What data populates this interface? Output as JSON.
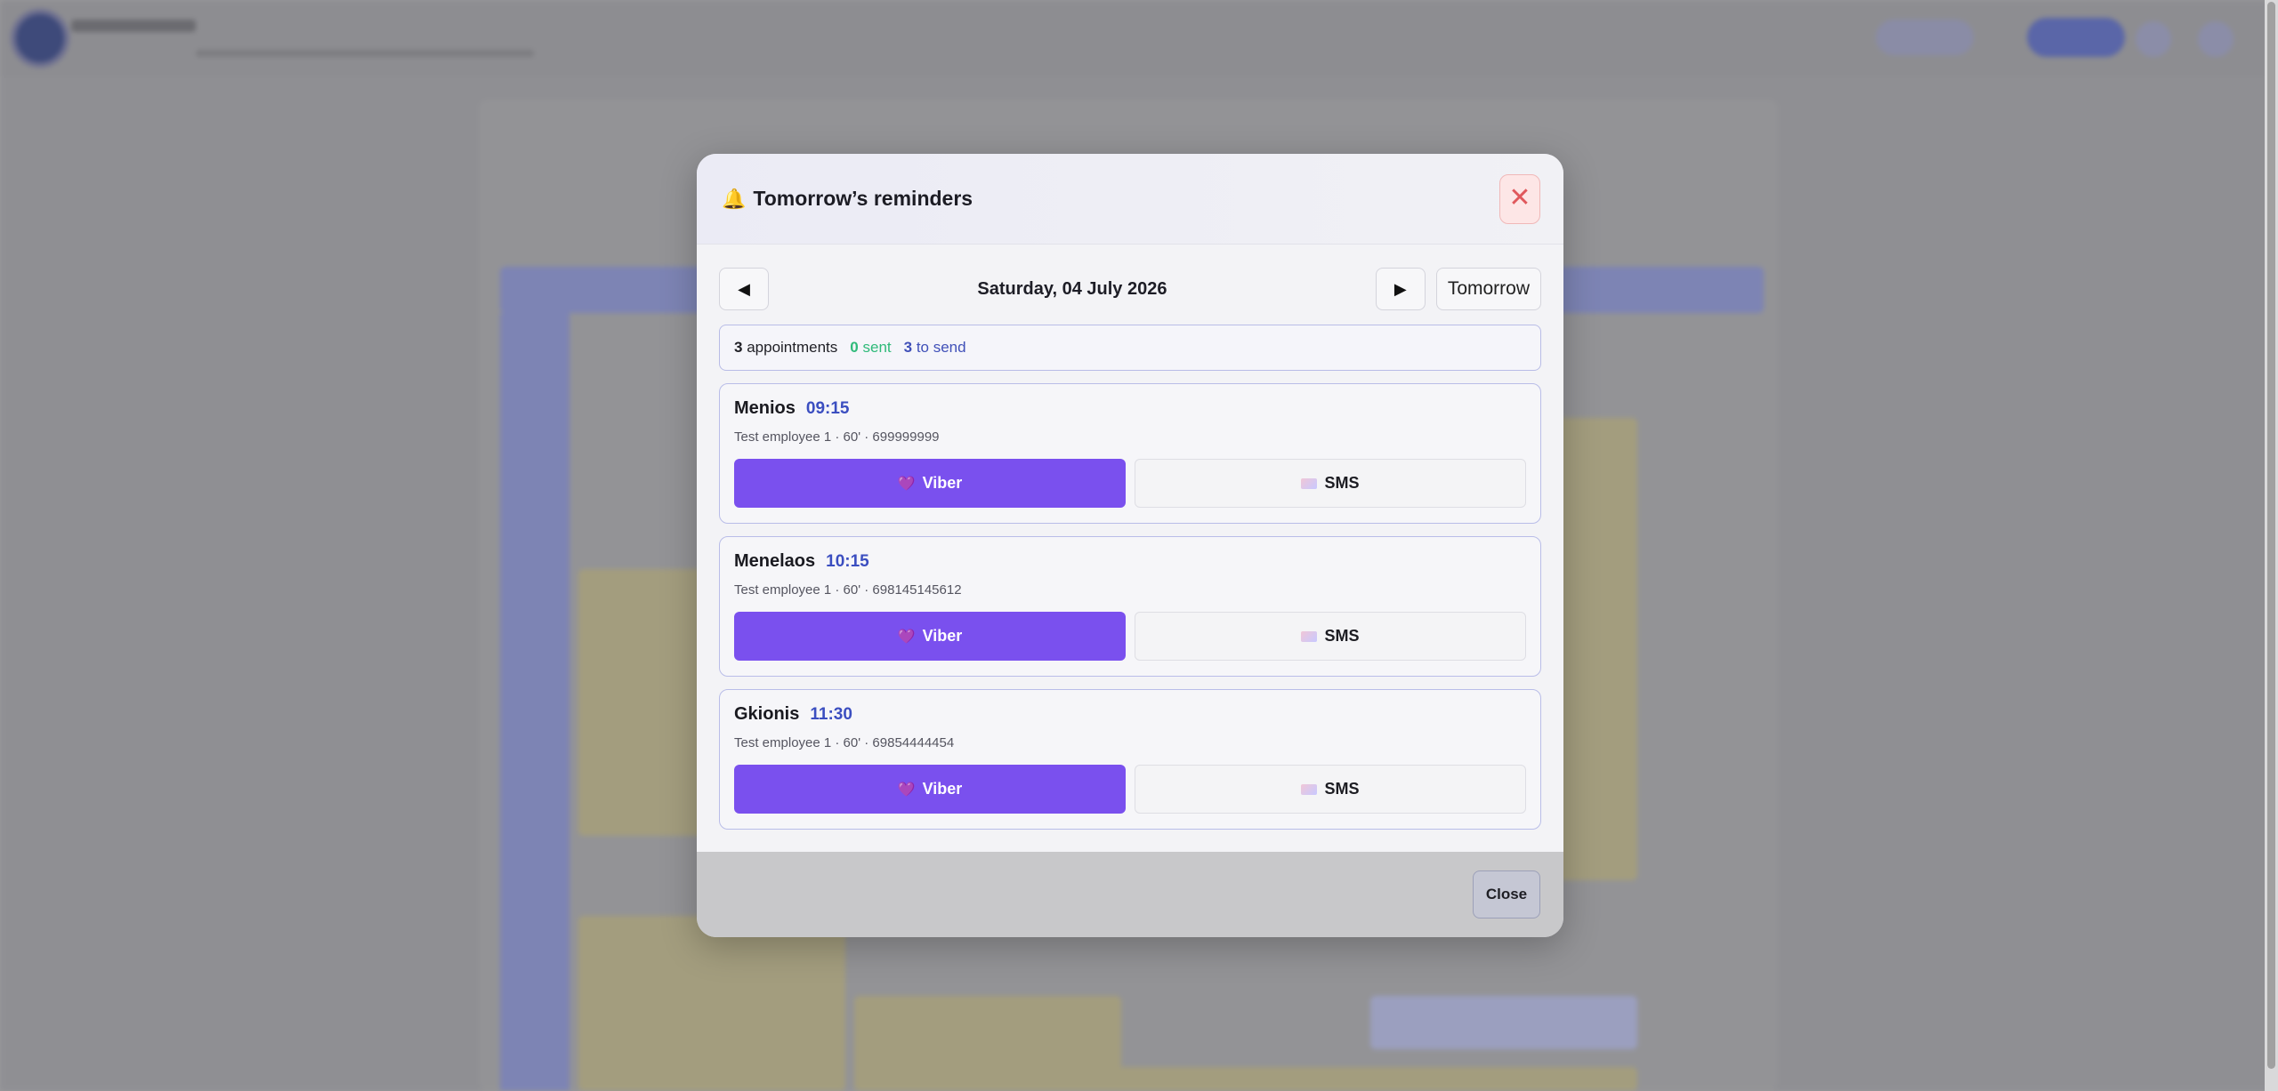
{
  "modal": {
    "title": "Tomorrow’s reminders",
    "bell_icon": "bell-icon",
    "close_icon": "close-icon",
    "date_label": "Saturday, 04 July 2026",
    "prev_icon": "◀",
    "next_icon": "▶",
    "tomorrow_label": "Tomorrow",
    "summary": {
      "appointments_count": "3",
      "appointments_label": "appointments",
      "sent_count": "0",
      "sent_label": "sent",
      "to_send_count": "3",
      "to_send_label": "to send"
    },
    "appointments": [
      {
        "name": "Menios",
        "time": "09:15",
        "meta": "Test employee 1 · 60' · 699999999",
        "viber_label": "Viber",
        "sms_label": "SMS"
      },
      {
        "name": "Menelaos",
        "time": "10:15",
        "meta": "Test employee 1 · 60' · 698145145612",
        "viber_label": "Viber",
        "sms_label": "SMS"
      },
      {
        "name": "Gkionis",
        "time": "11:30",
        "meta": "Test employee 1 · 60' · 69854444454",
        "viber_label": "Viber",
        "sms_label": "SMS"
      }
    ],
    "footer_close_label": "Close"
  },
  "colors": {
    "viber": "#7a50ee",
    "sent": "#2fba79",
    "to_send": "#4050b8",
    "time": "#3b4ec0",
    "close_x": "#e0585c"
  }
}
